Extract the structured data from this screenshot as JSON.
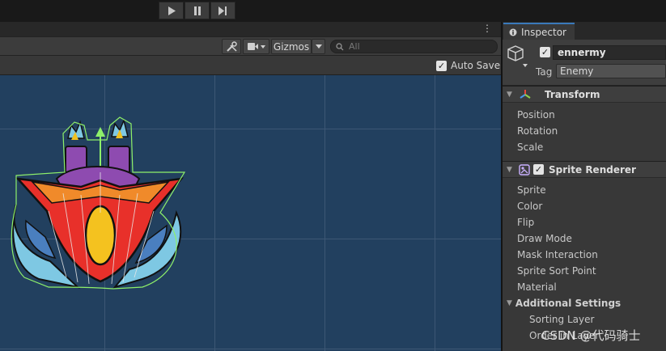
{
  "playbar": {
    "play_icon": "play-icon",
    "pause_icon": "pause-icon",
    "step_icon": "step-icon"
  },
  "scene": {
    "kebab": "⋮",
    "toolbar": {
      "tools_icon": "tools-icon",
      "camera_icon": "camera-icon",
      "gizmos_label": "Gizmos",
      "search_placeholder": "All"
    },
    "auto_save_label": "Auto Save",
    "auto_save_checked": true,
    "viewport_bg": "#22405f",
    "sprite_name": "enemy-spaceship"
  },
  "inspector": {
    "tab_label": "Inspector",
    "object_name": "ennermy",
    "active_checked": true,
    "tag_label": "Tag",
    "tag_value": "Enemy",
    "transform": {
      "title": "Transform",
      "props": [
        "Position",
        "Rotation",
        "Scale"
      ]
    },
    "sprite_renderer": {
      "title": "Sprite Renderer",
      "enabled": true,
      "props": [
        "Sprite",
        "Color",
        "Flip",
        "Draw Mode",
        "Mask Interaction",
        "Sprite Sort Point",
        "Material"
      ],
      "additional_settings": "Additional Settings",
      "sub_props": [
        "Sorting Layer",
        "Order in Layer"
      ]
    }
  },
  "watermark": "CSDN @代码骑士",
  "colors": {
    "accent": "#3a79bb",
    "gizmo_outline": "#8ef06a"
  }
}
